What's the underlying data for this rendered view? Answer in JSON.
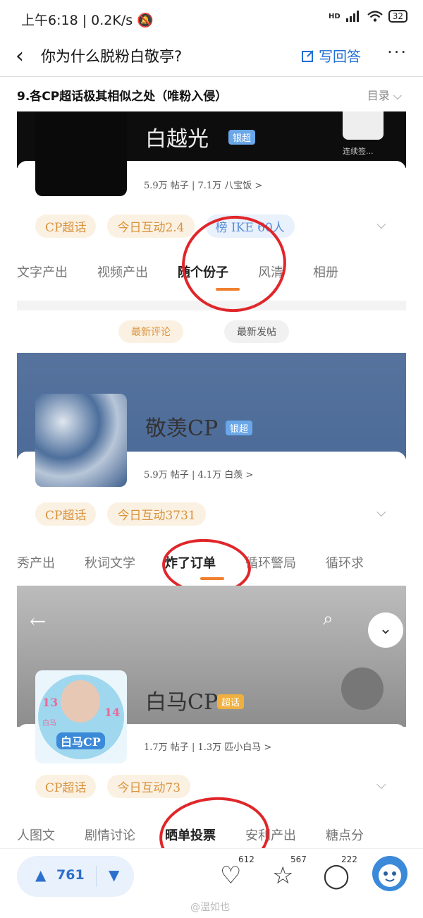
{
  "status_bar": {
    "time_speed": "上午6:18 | 0.2K/s",
    "bell": "🔕",
    "net": "HD",
    "battery": "32"
  },
  "nav": {
    "title": "你为什么脱粉白敬亭?",
    "write": "写回答"
  },
  "section": {
    "title": "9.各CP超话极其相似之处（唯粉入侵）",
    "toc": "目录"
  },
  "card1": {
    "name": "白越光",
    "level": "银超",
    "checkin": "连续签...",
    "stats": "5.9万 帖子 | 7.1万 八宝饭 >",
    "chips": [
      "CP超话",
      "今日互动2.4",
      "榜 IKE 60人"
    ],
    "tabs": [
      "文字产出",
      "视频产出",
      "随个份子",
      "风清",
      "相册"
    ],
    "buttons": [
      "最新评论",
      "最新发帖"
    ]
  },
  "card2": {
    "name": "敬羡CP",
    "level": "银超",
    "stats": "5.9万 帖子 | 4.1万 白羡 >",
    "chips": [
      "CP超话",
      "今日互动3731"
    ],
    "tabs": [
      "秀产出",
      "秋词文学",
      "炸了订单",
      "循环警局",
      "循环求"
    ]
  },
  "card3": {
    "name": "白马CP",
    "level": "超话",
    "avatar_text": {
      "left": "13",
      "right": "14",
      "center": "白马CP",
      "top": "白马"
    },
    "stats": "1.7万 帖子 | 1.3万 匹小白马 >",
    "chips": [
      "CP超话",
      "今日互动73"
    ],
    "tabs": [
      "人图文",
      "剧情讨论",
      "晒单投票",
      "安利产出",
      "糖点分"
    ]
  },
  "bottom": {
    "votes": "761",
    "likes": "612",
    "favorites": "567",
    "comments": "222",
    "watermark": "@温如也"
  },
  "colors": {
    "accent": "#1f6fd6",
    "orange": "#f08030",
    "red_circle": "#e0262a"
  }
}
